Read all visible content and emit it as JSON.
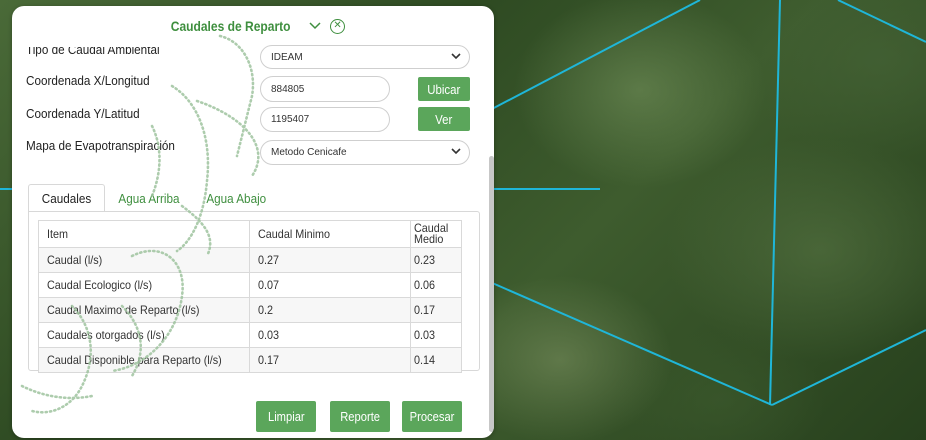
{
  "panel": {
    "title": "Caudales de Reparto",
    "fields": {
      "tipo_caudal_label": "Tipo de Caudal Ambiental",
      "tipo_caudal_value": "IDEAM",
      "coord_x_label": "Coordenada X/Longitud",
      "coord_x_value": "884805",
      "coord_y_label": "Coordenada Y/Latitud",
      "coord_y_value": "1195407",
      "mapa_label": "Mapa de Evapotranspiración",
      "mapa_value": "Metodo Cenicafe"
    },
    "buttons": {
      "ubicar": "Ubicar",
      "ver": "Ver",
      "limpiar": "Limpiar",
      "reporte": "Reporte",
      "procesar": "Procesar"
    },
    "tabs": [
      "Caudales",
      "Agua Arriba",
      "Agua Abajo"
    ],
    "table": {
      "headers": [
        "Item",
        "Caudal Minimo",
        "Caudal Medio"
      ],
      "rows": [
        [
          "Caudal (l/s)",
          "0.27",
          "0.23"
        ],
        [
          "Caudal Ecologico (l/s)",
          "0.07",
          "0.06"
        ],
        [
          "Caudal Maximo de Reparto (l/s)",
          "0.2",
          "0.17"
        ],
        [
          "Caudales otorgados (l/s)",
          "0.03",
          "0.03"
        ],
        [
          "Caudal Disponible para Reparto (l/s)",
          "0.17",
          "0.14"
        ]
      ]
    },
    "icons": {
      "collapse": "chevron-down-icon",
      "close": "close-circle-icon",
      "select_arrow": "chevron-down-icon"
    }
  },
  "colors": {
    "accent_green": "#5ba65b",
    "title_green": "#3f8f3f",
    "map_line": "#1fb6d8"
  }
}
